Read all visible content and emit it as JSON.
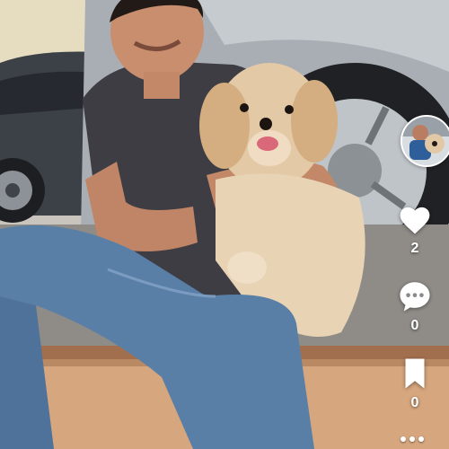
{
  "feed": {
    "post": {
      "media_description_icon": "photo",
      "creator_avatar_icon": "avatar"
    },
    "actions": {
      "like": {
        "icon": "heart-icon",
        "count": "2"
      },
      "comment": {
        "icon": "comment-bubble-icon",
        "count": "0"
      },
      "save": {
        "icon": "bookmark-icon",
        "count": "0"
      },
      "more": {
        "icon": "more-dots-icon"
      }
    },
    "accent": "#ffffff"
  }
}
